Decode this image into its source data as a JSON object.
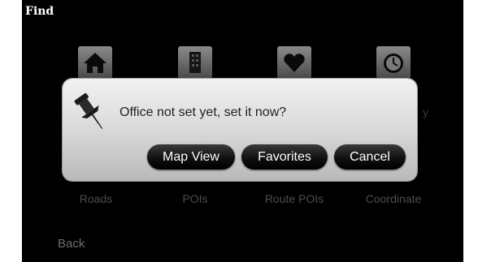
{
  "header": {
    "title": "Find"
  },
  "grid": {
    "icons": [
      "home-icon",
      "office-building-icon",
      "heart-icon",
      "clock-icon"
    ],
    "labels": [
      "Roads",
      "POIs",
      "Route POIs",
      "Coordinate"
    ],
    "partial_label_right": "y"
  },
  "dialog": {
    "message": "Office not set yet, set it now?",
    "icon": "pushpin-icon",
    "buttons": {
      "map_view": "Map View",
      "favorites": "Favorites",
      "cancel": "Cancel"
    }
  },
  "footer": {
    "back_label": "Back"
  },
  "colors": {
    "screen_bg": "#000000",
    "dialog_bg": "#dcdcdc",
    "button_bg": "#101010",
    "dim_label": "#4d4d4d"
  }
}
